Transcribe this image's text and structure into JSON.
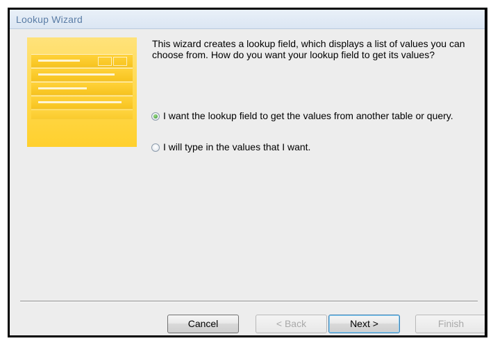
{
  "window": {
    "title": "Lookup Wizard"
  },
  "description": "This wizard creates a lookup field, which displays a list of values you can choose from.  How do you want your lookup field to get its values?",
  "options": [
    {
      "label": "I want the lookup field to get the values from another table or query.",
      "selected": true
    },
    {
      "label": "I will type in the values that I want.",
      "selected": false
    }
  ],
  "buttons": {
    "cancel": "Cancel",
    "back": "< Back",
    "next": "Next >",
    "finish": "Finish"
  },
  "colors": {
    "title_text": "#5a7da6",
    "graphic_yellow": "#ffd84b",
    "dialog_background": "#ededed"
  }
}
